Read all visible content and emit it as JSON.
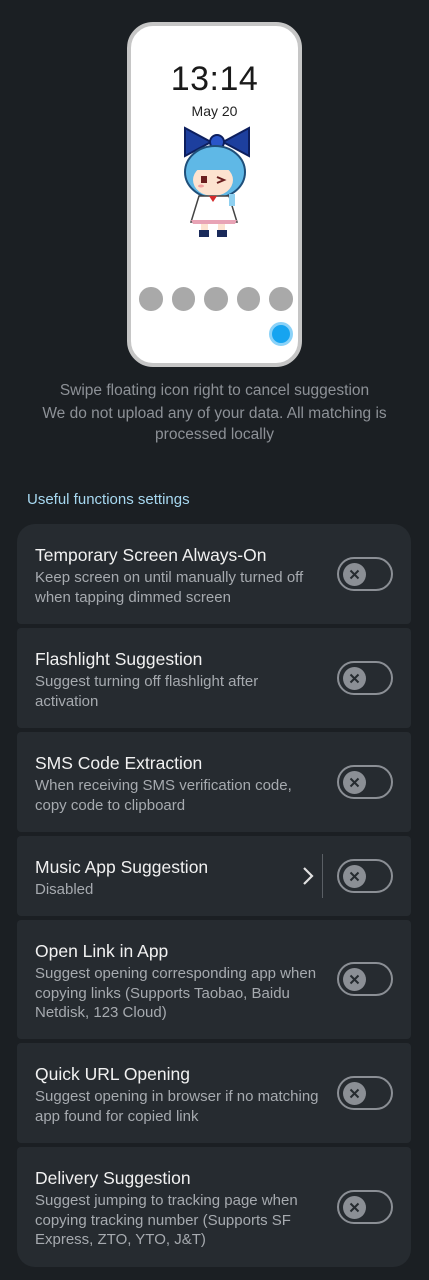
{
  "preview": {
    "time": "13:14",
    "date": "May 20",
    "dot_count": 5
  },
  "hints": {
    "swipe": "Swipe floating icon right to cancel suggestion",
    "privacy": "We do not upload any of your data. All matching is processed locally"
  },
  "section_title": "Useful functions settings",
  "settings": [
    {
      "title": "Temporary Screen Always-On",
      "desc": "Keep screen on until manually turned off when tapping dimmed screen",
      "enabled": false
    },
    {
      "title": "Flashlight Suggestion",
      "desc": "Suggest turning off flashlight after activation",
      "enabled": false
    },
    {
      "title": "SMS Code Extraction",
      "desc": "When receiving SMS verification code, copy code to clipboard",
      "enabled": false
    },
    {
      "title": "Music App Suggestion",
      "desc": "Disabled",
      "enabled": false,
      "has_detail": true
    },
    {
      "title": "Open Link in App",
      "desc": "Suggest opening corresponding app when copying links (Supports Taobao, Baidu Netdisk, 123 Cloud)",
      "enabled": false
    },
    {
      "title": "Quick URL Opening",
      "desc": "Suggest opening in browser if no matching app found for copied link",
      "enabled": false
    },
    {
      "title": "Delivery Suggestion",
      "desc": "Suggest jumping to tracking page when copying tracking number (Supports SF Express, ZTO, YTO, J&T)",
      "enabled": false
    }
  ],
  "colors": {
    "background": "#1b1f23",
    "card": "#262b30",
    "accent": "#a7d8f0",
    "floating_icon": "#16a4f0"
  }
}
